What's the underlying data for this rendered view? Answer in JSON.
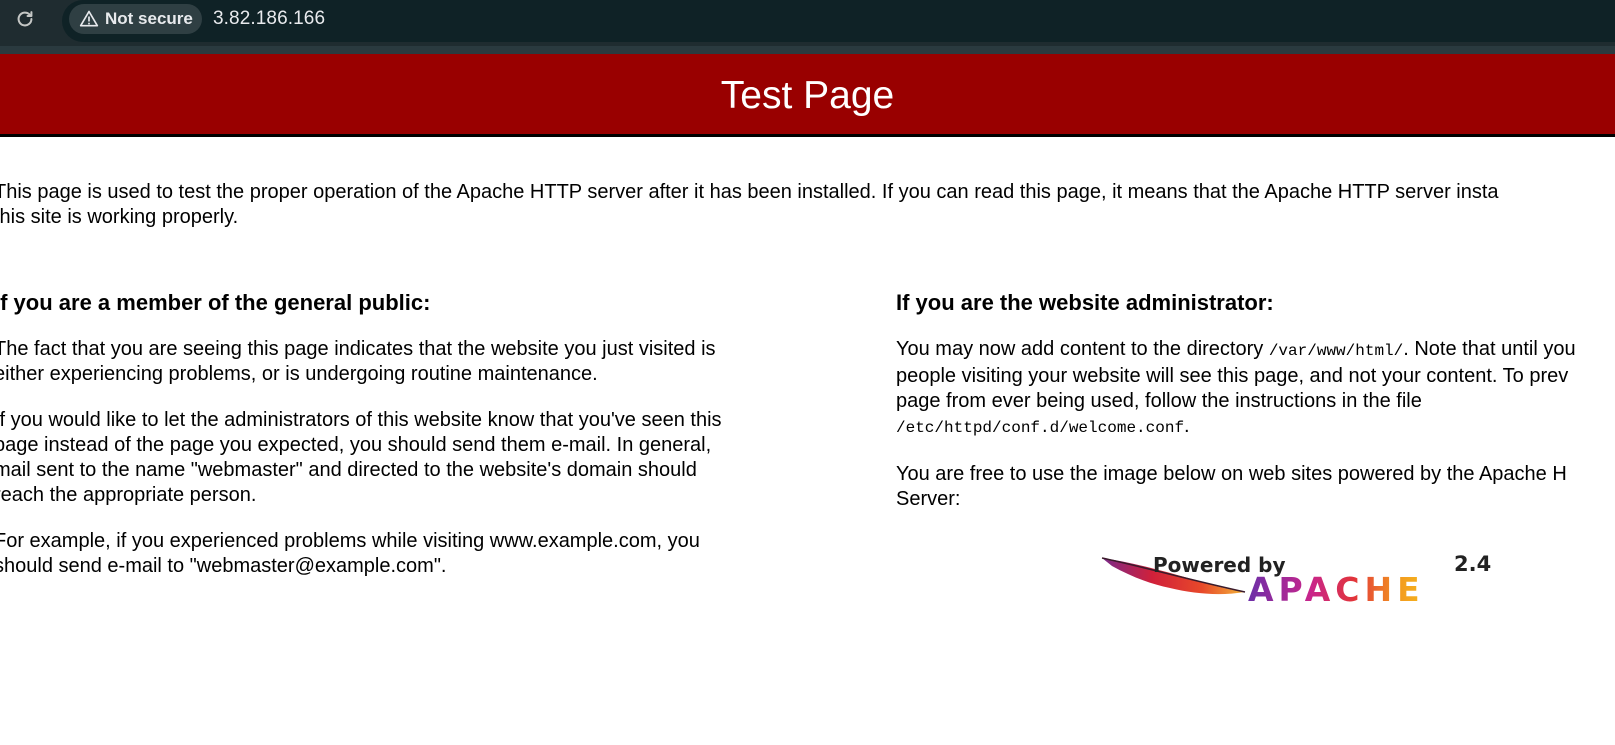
{
  "browser": {
    "security_label": "Not secure",
    "url": "3.82.186.166"
  },
  "header": {
    "title": "Test Page"
  },
  "intro": [
    "This page is used to test the proper operation of the Apache HTTP server after it has been installed. If you can read this page, it means that the Apache HTTP server insta",
    "this site is working properly."
  ],
  "public": {
    "heading": "If you are a member of the general public:",
    "para1": [
      "The fact that you are seeing this page indicates that the website you just visited is",
      "either experiencing problems, or is undergoing routine maintenance."
    ],
    "para2": [
      "If you would like to let the administrators of this website know that you've seen this",
      "page instead of the page you expected, you should send them e-mail. In general,",
      "mail sent to the name \"webmaster\" and directed to the website's domain should",
      "reach the appropriate person."
    ],
    "para3": [
      "For example, if you experienced problems while visiting www.example.com, you",
      "should send e-mail to \"webmaster@example.com\"."
    ]
  },
  "admin": {
    "heading": "If you are the website administrator:",
    "para1_a": "You may now add content to the directory ",
    "para1_code1": "/var/www/html/",
    "para1_b": ". Note that until you",
    "para1_line2": "people visiting your website will see this page, and not your content. To prev",
    "para1_line3": "page from ever being used, follow the instructions in the file",
    "para1_code2": "/etc/httpd/conf.d/welcome.conf",
    "para1_end": ".",
    "para2": [
      "You are free to use the image below on web sites powered by the Apache H",
      "Server:"
    ]
  },
  "badge": {
    "powered_by": "Powered by",
    "version": "2.4",
    "name": "APACHE"
  }
}
